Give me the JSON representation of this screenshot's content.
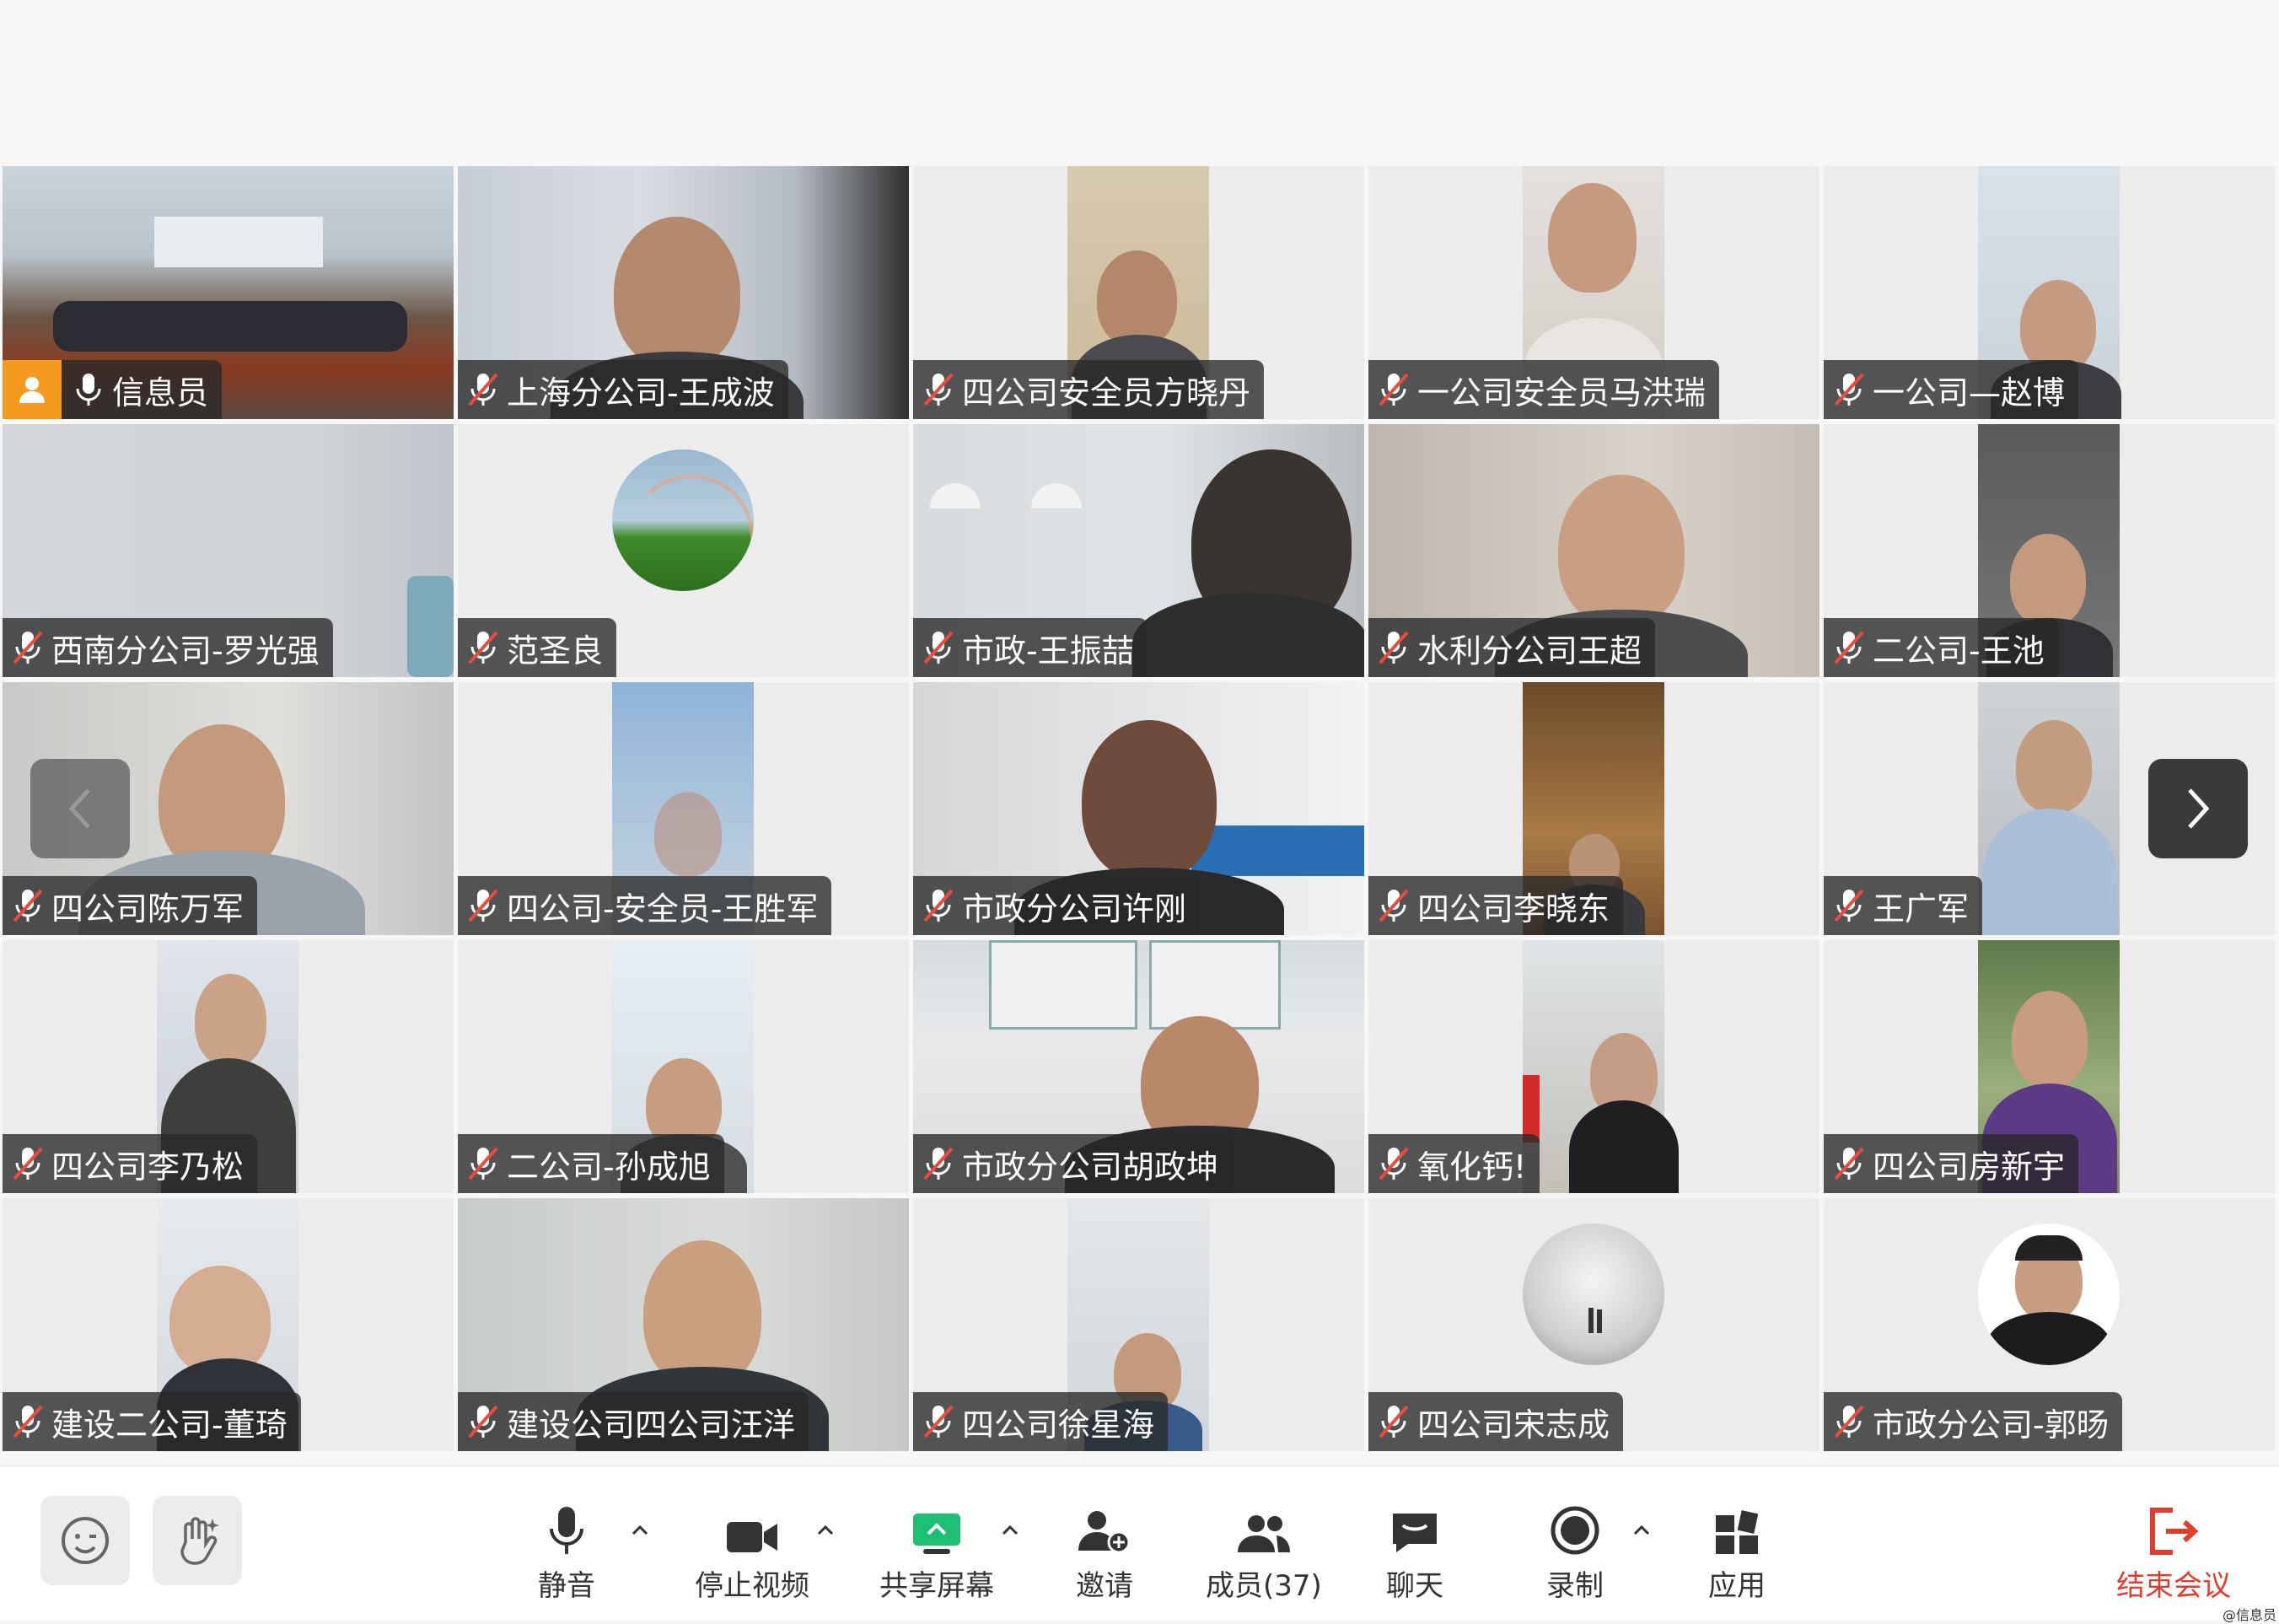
{
  "participants": [
    {
      "name": "信息员",
      "muted": false,
      "host": true
    },
    {
      "name": "上海分公司-王成波",
      "muted": true
    },
    {
      "name": "四公司安全员方晓丹",
      "muted": true
    },
    {
      "name": "一公司安全员马洪瑞",
      "muted": true
    },
    {
      "name": "一公司—赵博",
      "muted": true
    },
    {
      "name": "西南分公司-罗光强",
      "muted": true
    },
    {
      "name": "范圣良",
      "muted": true
    },
    {
      "name": "市政-王振喆",
      "muted": true
    },
    {
      "name": "水利分公司王超",
      "muted": true
    },
    {
      "name": "二公司-王池",
      "muted": true
    },
    {
      "name": "四公司陈万军",
      "muted": true
    },
    {
      "name": "四公司-安全员-王胜军",
      "muted": true
    },
    {
      "name": "市政分公司许刚",
      "muted": true
    },
    {
      "name": "四公司李晓东",
      "muted": true
    },
    {
      "name": "王广军",
      "muted": true
    },
    {
      "name": "四公司李乃松",
      "muted": true
    },
    {
      "name": "二公司-孙成旭",
      "muted": true
    },
    {
      "name": "市政分公司胡政坤",
      "muted": true
    },
    {
      "name": "氧化钙!",
      "muted": true
    },
    {
      "name": "四公司房新宇",
      "muted": true
    },
    {
      "name": "建设二公司-董琦",
      "muted": true
    },
    {
      "name": "建设公司四公司汪洋",
      "muted": true
    },
    {
      "name": "四公司徐星海",
      "muted": true
    },
    {
      "name": "四公司宋志成",
      "muted": true
    },
    {
      "name": "市政分公司-郭旸",
      "muted": true
    }
  ],
  "toolbar": {
    "mute": "静音",
    "stop_video": "停止视频",
    "share_screen": "共享屏幕",
    "invite": "邀请",
    "members": "成员(37)",
    "chat": "聊天",
    "record": "录制",
    "apps": "应用",
    "end_meeting": "结束会议"
  },
  "watermark": "@信息员",
  "colors": {
    "host_badge": "#f39a1f",
    "end_red": "#e23c2f",
    "share_green": "#1dbf73"
  }
}
